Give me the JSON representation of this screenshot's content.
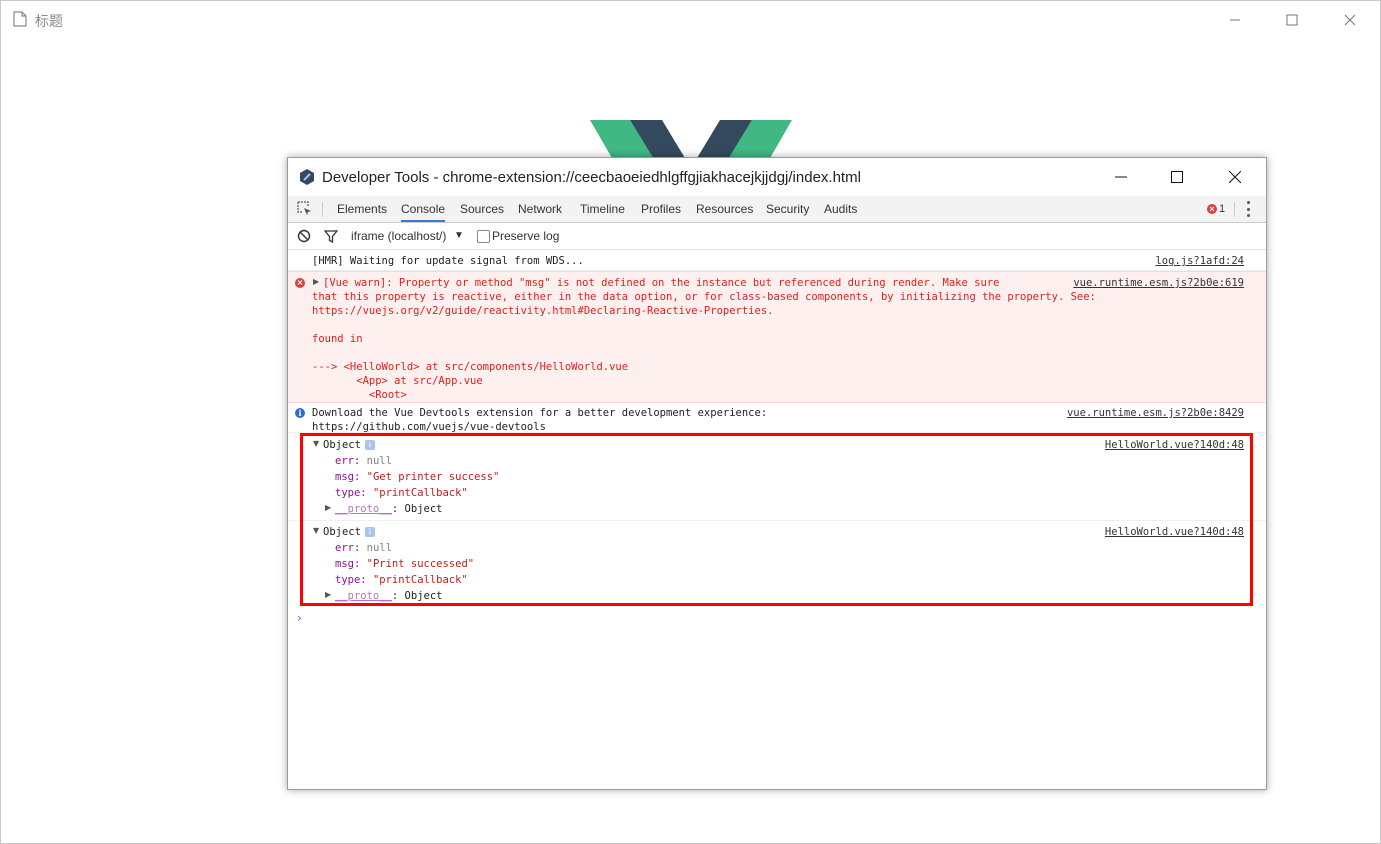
{
  "outer_window": {
    "title": "标题"
  },
  "devtools": {
    "title": "Developer Tools - chrome-extension://ceecbaoeiedhlgffgjiakhacejkjjdgj/index.html",
    "tabs": [
      {
        "label": "Elements"
      },
      {
        "label": "Console",
        "active": true
      },
      {
        "label": "Sources"
      },
      {
        "label": "Network"
      },
      {
        "label": "Timeline"
      },
      {
        "label": "Profiles"
      },
      {
        "label": "Resources"
      },
      {
        "label": "Security"
      },
      {
        "label": "Audits"
      }
    ],
    "error_count": "1",
    "filter": {
      "context": "iframe (localhost/)",
      "preserve_log_label": "Preserve log",
      "preserve_log_checked": false
    }
  },
  "console": {
    "hmr": {
      "text": "[HMR] Waiting for update signal from WDS...",
      "source": "log.js?1afd:24"
    },
    "vue_warn": {
      "text": "[Vue warn]: Property or method \"msg\" is not defined on the instance but referenced during render. Make sure\nthat this property is reactive, either in the data option, or for class-based components, by initializing the property. See:\nhttps://vuejs.org/v2/guide/reactivity.html#Declaring-Reactive-Properties.\n\nfound in\n\n---> <HelloWorld> at src/components/HelloWorld.vue\n       <App> at src/App.vue\n         <Root>",
      "source": "vue.runtime.esm.js?2b0e:619"
    },
    "info": {
      "text": "Download the Vue Devtools extension for a better development experience:\nhttps://github.com/vuejs/vue-devtools",
      "source": "vue.runtime.esm.js?2b0e:8429"
    },
    "objects": [
      {
        "label": "Object",
        "source": "HelloWorld.vue?140d:48",
        "err_key": "err:",
        "err_val": "null",
        "msg_key": "msg:",
        "msg_val": "\"Get printer success\"",
        "type_key": "type:",
        "type_val": "\"printCallback\"",
        "proto_key": "__proto__",
        "proto_val": ": Object"
      },
      {
        "label": "Object",
        "source": "HelloWorld.vue?140d:48",
        "err_key": "err:",
        "err_val": "null",
        "msg_key": "msg:",
        "msg_val": "\"Print successed\"",
        "type_key": "type:",
        "type_val": "\"printCallback\"",
        "proto_key": "__proto__",
        "proto_val": ": Object"
      }
    ],
    "prompt": "›"
  },
  "colors": {
    "error_red": "#e0201c",
    "highlight_red": "#ff0000",
    "active_tab_blue": "#3879d9",
    "vue_green": "#41b883",
    "vue_dark": "#35495e"
  },
  "icons": {
    "outer_doc": "document-icon",
    "inspect": "inspect-element-icon",
    "clear": "clear-console-icon",
    "filter": "filter-icon"
  }
}
